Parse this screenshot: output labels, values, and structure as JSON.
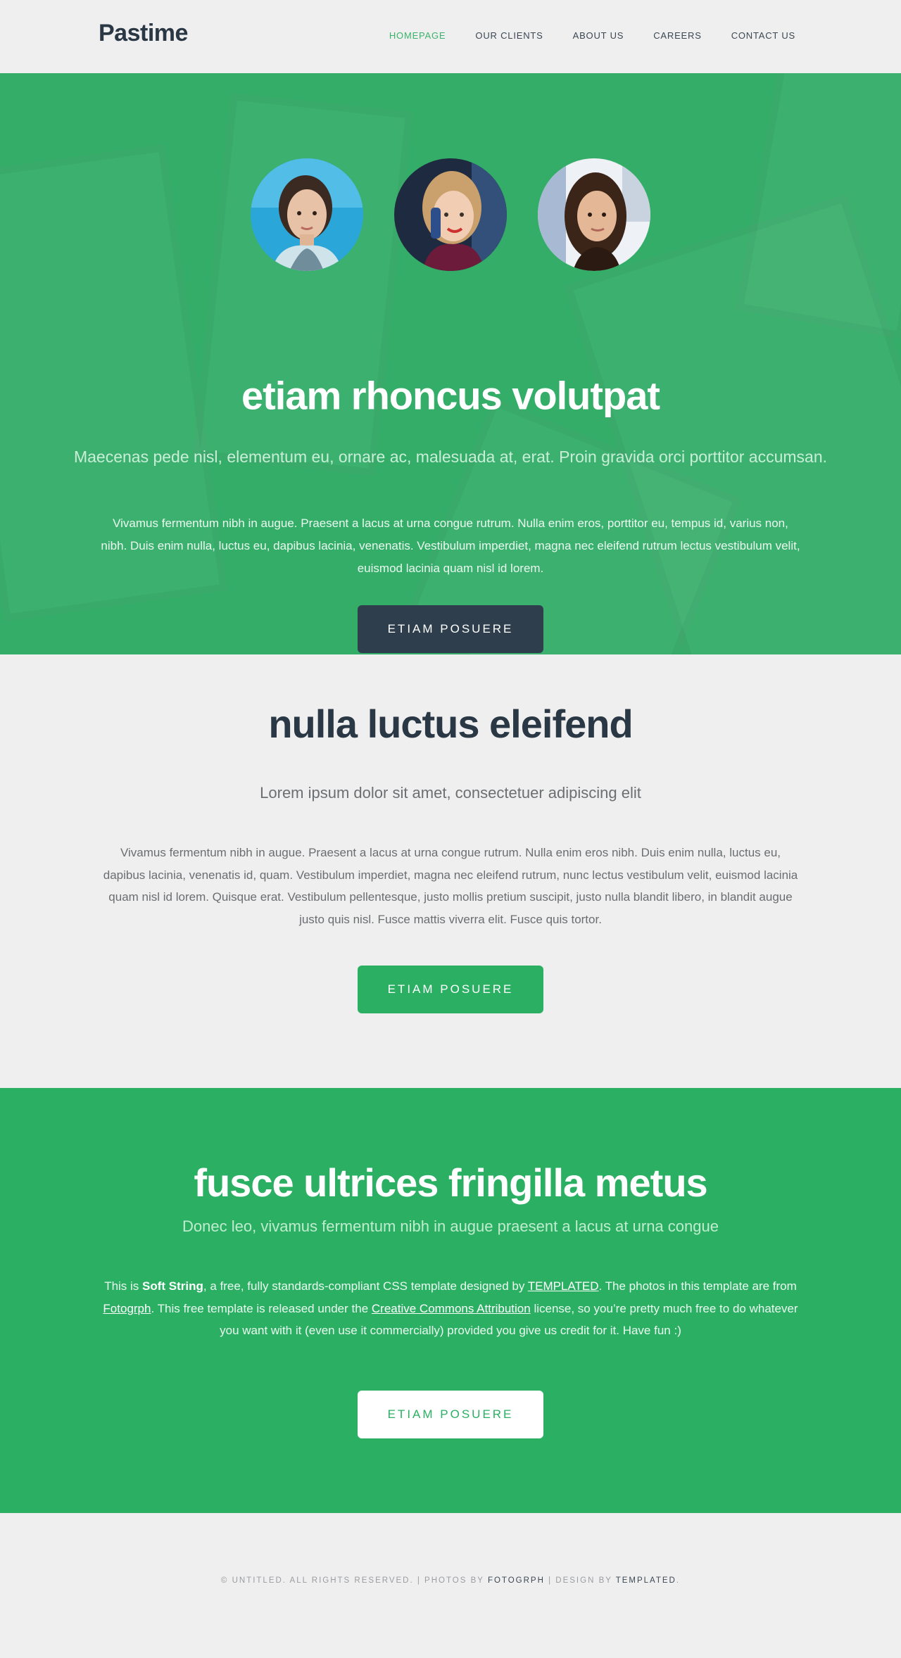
{
  "header": {
    "logo": "Pastime",
    "nav": [
      {
        "label": "HOMEPAGE",
        "active": true
      },
      {
        "label": "OUR CLIENTS",
        "active": false
      },
      {
        "label": "ABOUT US",
        "active": false
      },
      {
        "label": "CAREERS",
        "active": false
      },
      {
        "label": "CONTACT US",
        "active": false
      }
    ]
  },
  "banner": {
    "title": "etiam rhoncus volutpat",
    "subtitle": "Maecenas pede nisl, elementum eu, ornare ac, malesuada at, erat. Proin gravida orci porttitor accumsan.",
    "body": "Vivamus fermentum nibh in augue. Praesent a lacus at urna congue rutrum. Nulla enim eros, porttitor eu, tempus id, varius non, nibh. Duis enim nulla, luctus eu, dapibus lacinia, venenatis. Vestibulum imperdiet, magna nec eleifend rutrum lectus vestibulum velit, euismod lacinia quam nisl id lorem.",
    "button": "ETIAM POSUERE",
    "avatars": [
      "avatar-woman-blue-background",
      "avatar-woman-on-phone",
      "avatar-woman-dark-hair"
    ]
  },
  "section2": {
    "title": "nulla luctus eleifend",
    "subtitle": "Lorem ipsum dolor sit amet, consectetuer adipiscing elit",
    "body": "Vivamus fermentum nibh in augue. Praesent a lacus at urna congue rutrum. Nulla enim eros nibh. Duis enim nulla, luctus eu, dapibus lacinia, venenatis id, quam. Vestibulum imperdiet, magna nec eleifend rutrum, nunc lectus vestibulum velit, euismod lacinia quam nisl id lorem. Quisque erat. Vestibulum pellentesque, justo mollis pretium suscipit, justo nulla blandit libero, in blandit augue justo quis nisl. Fusce mattis viverra elit. Fusce quis tortor.",
    "button": "ETIAM POSUERE"
  },
  "section3": {
    "title": "fusce ultrices fringilla metus",
    "subtitle": "Donec leo, vivamus fermentum nibh in augue praesent a lacus at urna congue",
    "body_parts": {
      "p1": "This is ",
      "b1": "Soft String",
      "p2": ", a free, fully standards-compliant CSS template designed by ",
      "a1": "TEMPLATED",
      "p3": ". The photos in this template are from ",
      "a2": "Fotogrph",
      "p4": ". This free template is released under the ",
      "a3": "Creative Commons Attribution",
      "p5": " license, so you’re pretty much free to do whatever you want with it (even use it commercially) provided you give us credit for it. Have fun :)"
    },
    "button": "ETIAM POSUERE"
  },
  "footer": {
    "copy_prefix": "© Untitled. All rights reserved. | Photos by ",
    "link1": "Fotogrph",
    "copy_mid": " | Design by ",
    "link2": "TEMPLATED",
    "copy_suffix": "."
  },
  "colors": {
    "brand_green": "#2bb063",
    "banner_green": "#34ad68",
    "dark_slate": "#2e3e4c",
    "nav_active": "#3bb36a",
    "background": "#efefef"
  }
}
